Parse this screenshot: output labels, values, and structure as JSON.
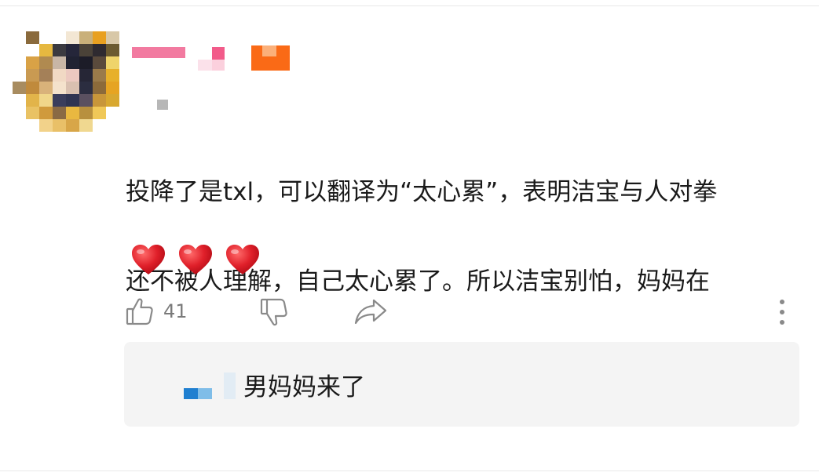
{
  "comment": {
    "text_lines": [
      "投降了是txl，可以翻译为“太心累”，表明洁宝与人对拳",
      "还不被人理解，自己太心累了。所以洁宝别怕，妈妈在"
    ],
    "emojis": [
      "heart-emoji",
      "heart-emoji",
      "heart-emoji"
    ]
  },
  "actions": {
    "like_count": "41",
    "like_icon": "thumbs-up-icon",
    "dislike_icon": "thumbs-down-icon",
    "share_icon": "share-icon",
    "more_icon": "more-vertical-icon"
  },
  "reply": {
    "text": "男妈妈来了"
  },
  "colors": {
    "heart_red": "#e0202a",
    "icon_gray": "#8a8a8a",
    "reply_bg": "#f4f4f4"
  }
}
